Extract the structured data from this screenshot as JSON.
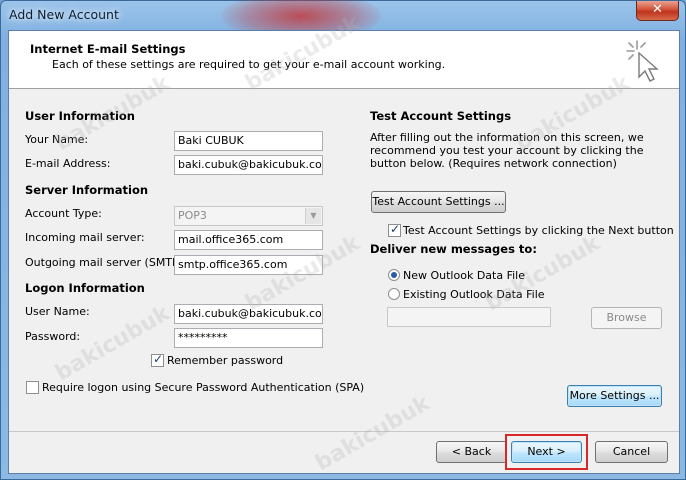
{
  "window": {
    "title": "Add New Account",
    "close_glyph": "✕"
  },
  "header": {
    "title": "Internet E-mail Settings",
    "subtitle": "Each of these settings are required to get your e-mail account working."
  },
  "user_info": {
    "heading": "User Information",
    "name_label": "Your Name:",
    "name_value": "Baki CUBUK",
    "email_label": "E-mail Address:",
    "email_value": "baki.cubuk@bakicubuk.com.tr"
  },
  "server_info": {
    "heading": "Server Information",
    "account_type_label": "Account Type:",
    "account_type_value": "POP3",
    "incoming_label": "Incoming mail server:",
    "incoming_value": "mail.office365.com",
    "outgoing_label": "Outgoing mail server (SMTP):",
    "outgoing_value": "smtp.office365.com"
  },
  "logon_info": {
    "heading": "Logon Information",
    "username_label": "User Name:",
    "username_value": "baki.cubuk@bakicubuk.com.tr",
    "password_label": "Password:",
    "password_value": "*********",
    "remember_label": "Remember password",
    "remember_checked": true,
    "spa_label": "Require logon using Secure Password Authentication (SPA)",
    "spa_checked": false
  },
  "test_settings": {
    "heading": "Test Account Settings",
    "description": "After filling out the information on this screen, we recommend you test your account by clicking the button below. (Requires network connection)",
    "test_button": "Test Account Settings ...",
    "test_next_label": "Test Account Settings by clicking the Next button",
    "test_next_checked": true
  },
  "deliver": {
    "heading": "Deliver new messages to:",
    "options": [
      "New Outlook Data File",
      "Existing Outlook Data File"
    ],
    "selected": "New Outlook Data File",
    "path_value": "",
    "browse_button": "Browse"
  },
  "more_settings_button": "More Settings ...",
  "footer": {
    "back_button": "< Back",
    "next_button": "Next >",
    "cancel_button": "Cancel"
  },
  "watermark": "bakicubuk",
  "colors": {
    "highlight": "#d62828",
    "close_button": "#c0321b",
    "title_glow": "#c82828"
  },
  "icons": {
    "wizard": "cursor-sparkle-icon",
    "checkbox": "checkmark-icon",
    "dropdown": "chevron-down-icon"
  }
}
